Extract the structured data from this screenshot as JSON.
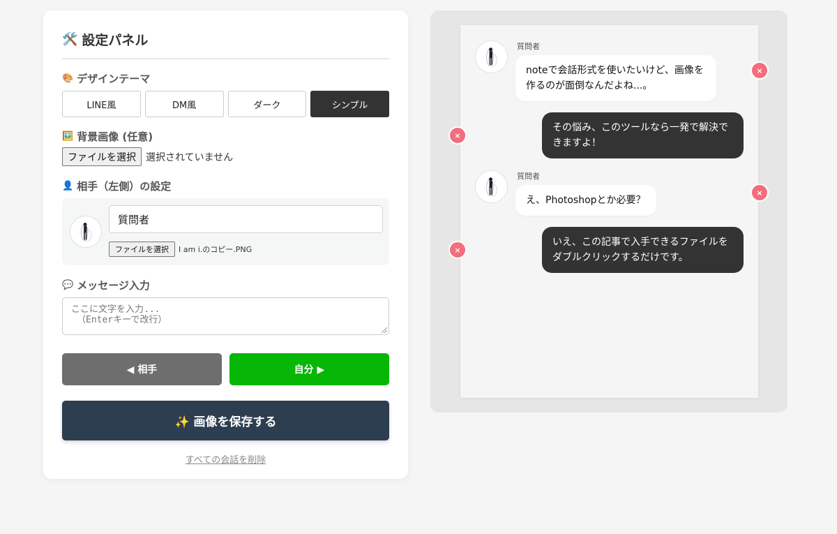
{
  "settings": {
    "title": "設定パネル",
    "title_icon": "hammer-wrench-icon",
    "theme_label": "デザインテーマ",
    "themes": [
      "LINE風",
      "DM風",
      "ダーク",
      "シンプル"
    ],
    "active_theme": "シンプル",
    "bg_label": "背景画像 (任意)",
    "bg_file_button": "ファイルを選択",
    "bg_file_status": "選択されていません",
    "partner_label": "相手（左側）の設定",
    "partner_name": "質問者",
    "partner_file_button": "ファイルを選択",
    "partner_file_name": "I am i.のコピー.PNG",
    "message_label": "メッセージ入力",
    "message_placeholder_line1": "ここに文字を入力...",
    "message_placeholder_line2": "（Enterキーで改行）",
    "partner_send": "◀ 相手",
    "self_send": "自分 ▶",
    "save_button": "✨ 画像を保存する",
    "clear_link": "すべての会話を削除"
  },
  "preview": {
    "messages": [
      {
        "side": "left",
        "sender": "質問者",
        "text": "noteで会話形式を使いたいけど、画像を作るのが面倒なんだよね...。"
      },
      {
        "side": "right",
        "text": "その悩み、このツールなら一発で解決できますよ！"
      },
      {
        "side": "left",
        "sender": "質問者",
        "text": "え、Photoshopとか必要？"
      },
      {
        "side": "right",
        "text": "いえ、この記事で入手できるファイルをダブルクリックするだけです。"
      }
    ],
    "delete_symbol": "×"
  }
}
